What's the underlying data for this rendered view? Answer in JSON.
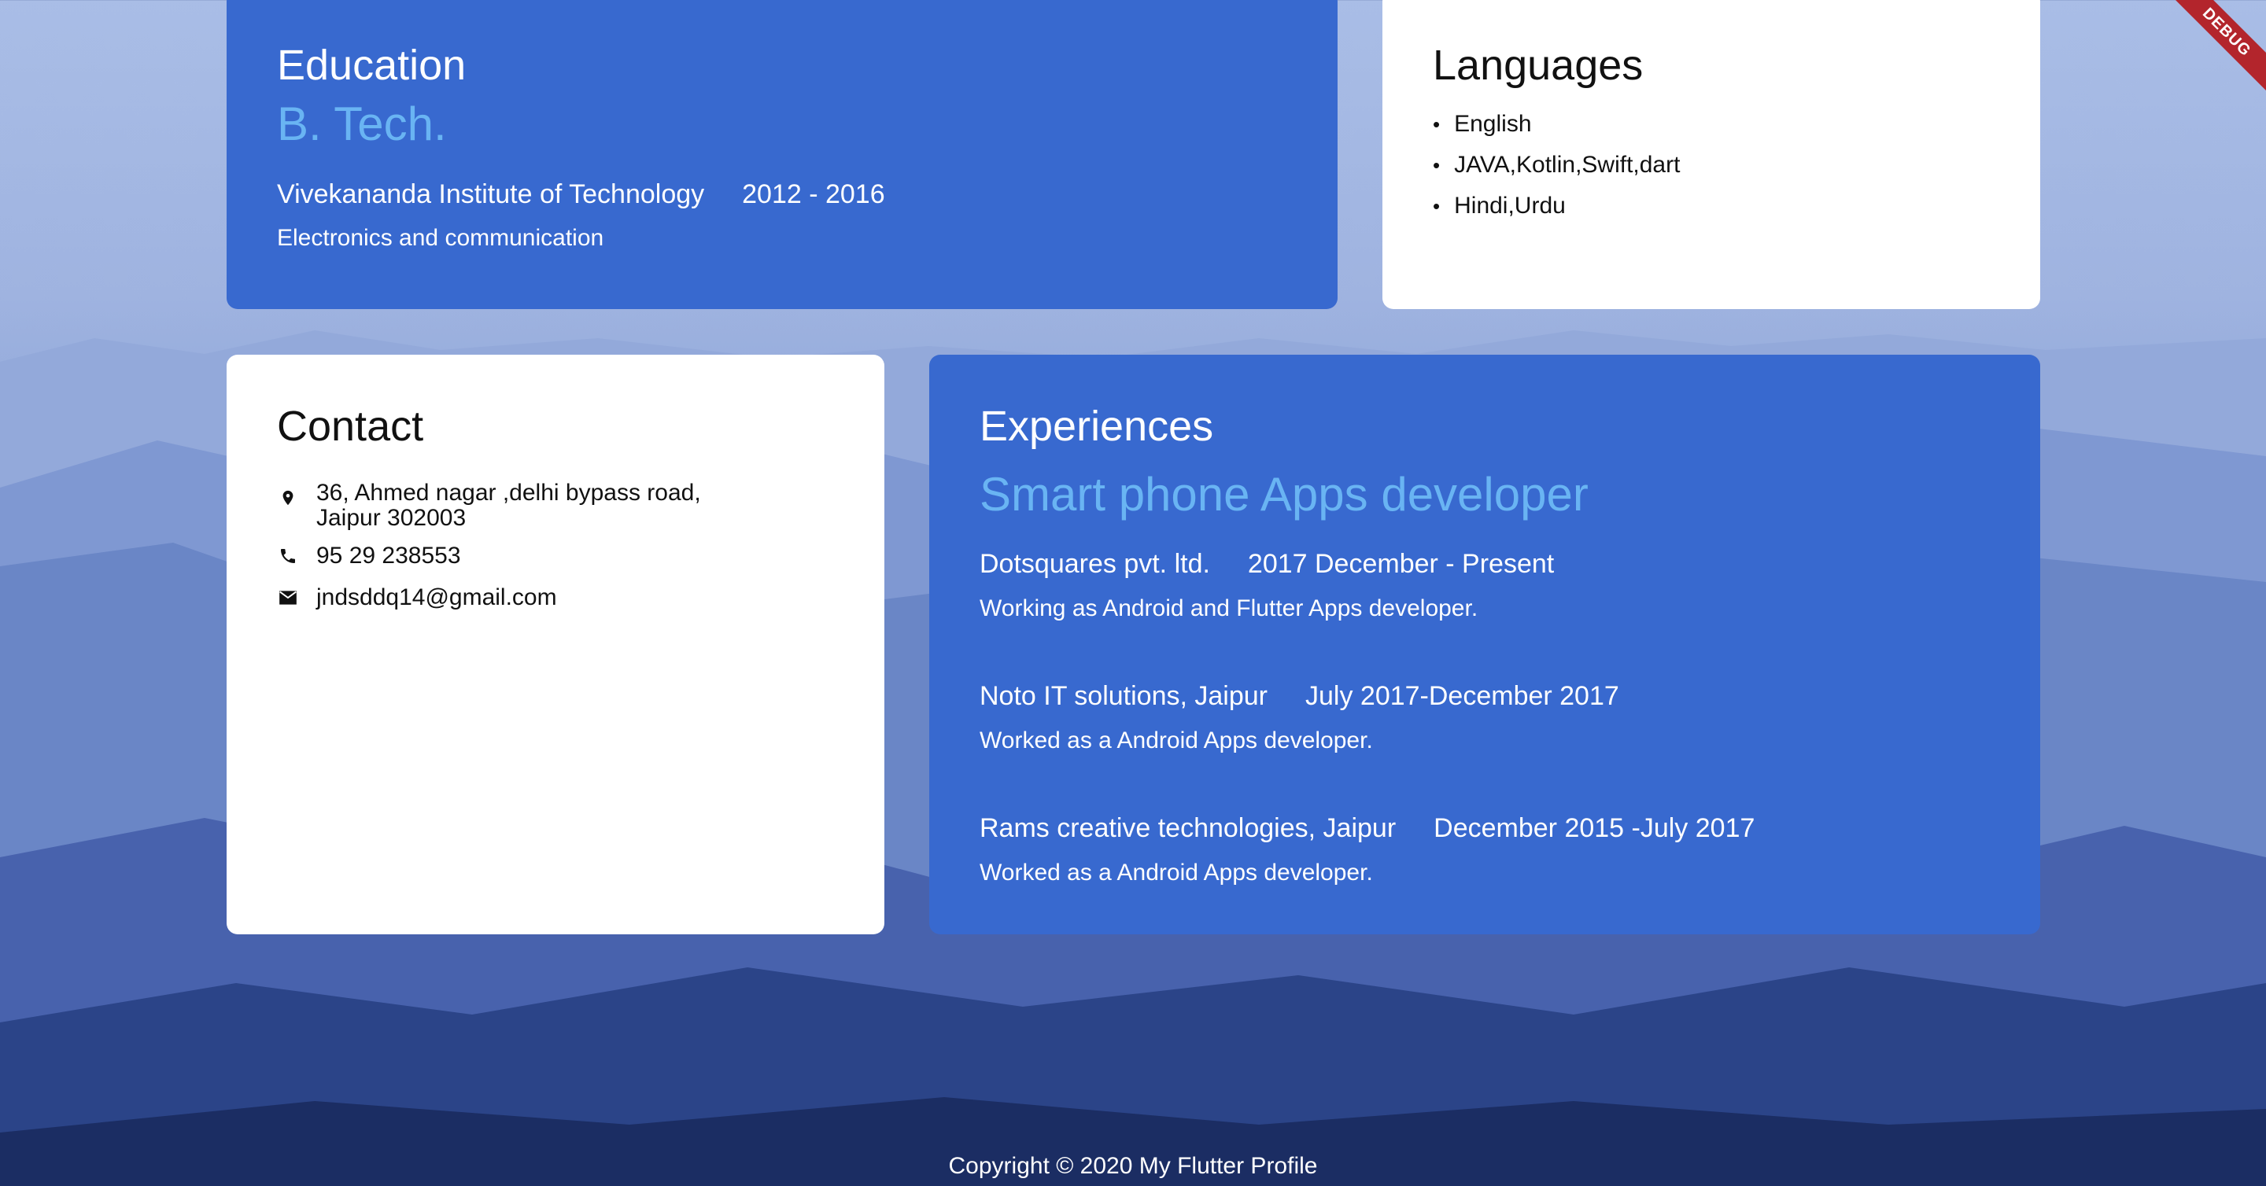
{
  "education": {
    "title": "Education",
    "degree": "B. Tech.",
    "institute": "Vivekananda Institute of Technology",
    "years": "2012 - 2016",
    "field": "Electronics and communication"
  },
  "languages": {
    "title": "Languages",
    "items": [
      "English",
      "JAVA,Kotlin,Swift,dart",
      "Hindi,Urdu"
    ]
  },
  "contact": {
    "title": "Contact",
    "address_line1": "36, Ahmed nagar ,delhi bypass road,",
    "address_line2": "Jaipur 302003",
    "phone": "95 29 238553",
    "email": "jndsddq14@gmail.com"
  },
  "experiences": {
    "title": "Experiences",
    "role": "Smart phone Apps developer",
    "jobs": [
      {
        "company": "Dotsquares pvt. ltd.",
        "period": "2017 December - Present",
        "desc": "Working as Android and Flutter Apps developer."
      },
      {
        "company": "Noto IT solutions, Jaipur",
        "period": "July 2017-December 2017",
        "desc": "Worked as a Android Apps developer."
      },
      {
        "company": "Rams creative technologies, Jaipur",
        "period": "December 2015 -July 2017",
        "desc": "Worked as a Android Apps developer."
      }
    ]
  },
  "footer": {
    "text": "Copyright © 2020 My Flutter Profile"
  },
  "debug_banner": "DEBUG",
  "colors": {
    "card_blue": "#3869cf",
    "accent_light_blue": "#69b4f3",
    "card_white": "#ffffff",
    "debug_red": "#b3252c"
  }
}
